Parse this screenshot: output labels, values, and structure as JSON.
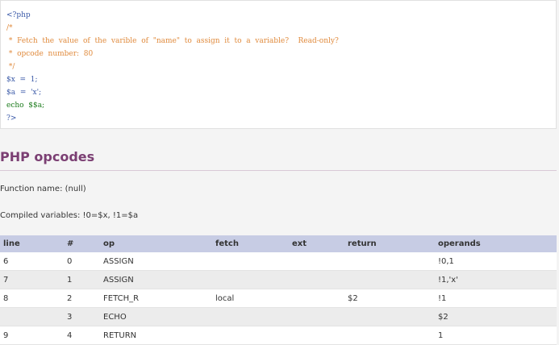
{
  "code": {
    "lines": [
      "<?php",
      "/*",
      " *  Fetch  the  value  of  the  varible  of  \"name\"  to  assign  it  to  a  variable?    Read-only?",
      " *  opcode  number:  80",
      " */",
      "$x  =  1;",
      "$a  =  'x';",
      "echo  $$a;",
      "?>"
    ]
  },
  "section": {
    "title": "PHP opcodes",
    "function_name": "Function name: (null)",
    "compiled_vars": "Compiled variables: !0=$x, !1=$a"
  },
  "table": {
    "headers": [
      "line",
      "#",
      "op",
      "fetch",
      "ext",
      "return",
      "operands"
    ],
    "rows": [
      [
        "6",
        "0",
        "ASSIGN",
        "",
        "",
        "",
        "!0,1"
      ],
      [
        "7",
        "1",
        "ASSIGN",
        "",
        "",
        "",
        "!1,'x'"
      ],
      [
        "8",
        "2",
        "FETCH_R",
        "local",
        "",
        "$2",
        "!1"
      ],
      [
        "",
        "3",
        "ECHO",
        "",
        "",
        "",
        "$2"
      ],
      [
        "9",
        "4",
        "RETURN",
        "",
        "",
        "",
        "1"
      ]
    ]
  }
}
